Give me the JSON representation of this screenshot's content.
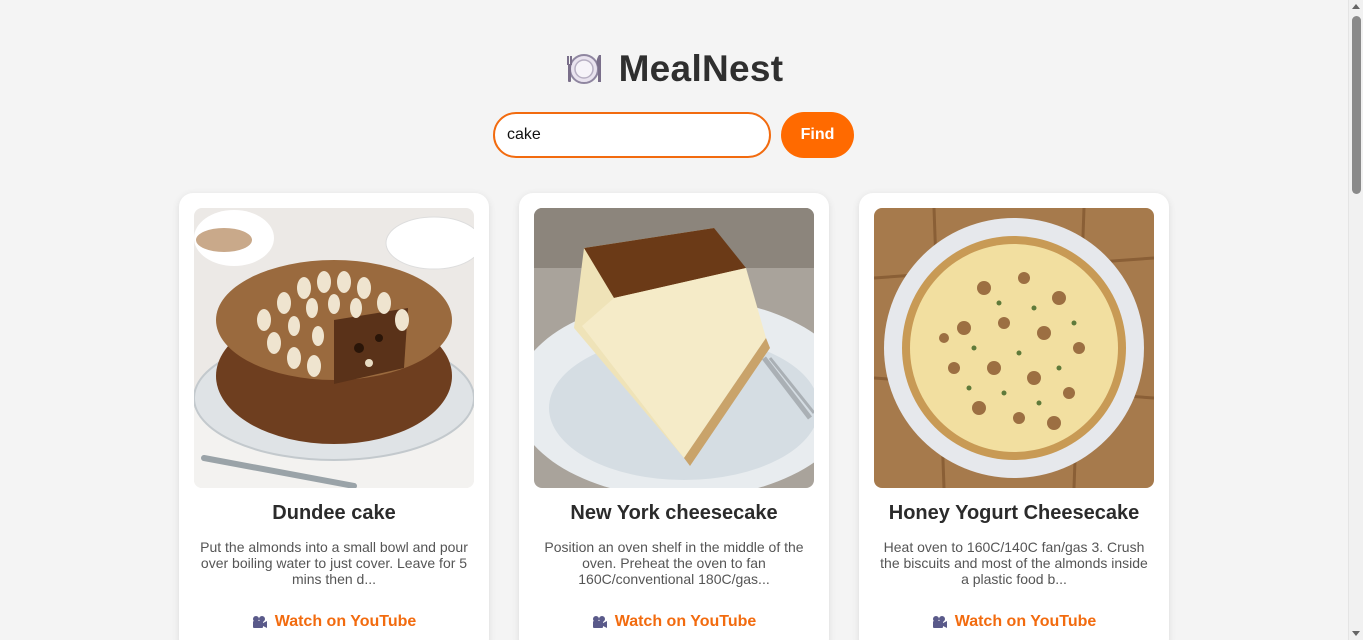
{
  "app": {
    "title": "MealNest",
    "logo_icon": "plate-with-cutlery-icon",
    "accent_color": "#ff6a00"
  },
  "search": {
    "value": "cake",
    "button_label": "Find"
  },
  "recipes": [
    {
      "title": "Dundee cake",
      "description": "Put the almonds into a small bowl and pour over boiling water to just cover. Leave for 5 mins then d...",
      "link_label": "Watch on YouTube",
      "link_icon": "video-camera-icon",
      "image": "dundee-cake-photo"
    },
    {
      "title": "New York cheesecake",
      "description": "Position an oven shelf in the middle of the oven. Preheat the oven to fan 160C/conventional 180C/gas...",
      "link_label": "Watch on YouTube",
      "link_icon": "video-camera-icon",
      "image": "new-york-cheesecake-photo"
    },
    {
      "title": "Honey Yogurt Cheesecake",
      "description": "Heat oven to 160C/140C fan/gas 3. Crush the biscuits and most of the almonds inside a plastic food b...",
      "link_label": "Watch on YouTube",
      "link_icon": "video-camera-icon",
      "image": "honey-yogurt-cheesecake-photo"
    }
  ]
}
